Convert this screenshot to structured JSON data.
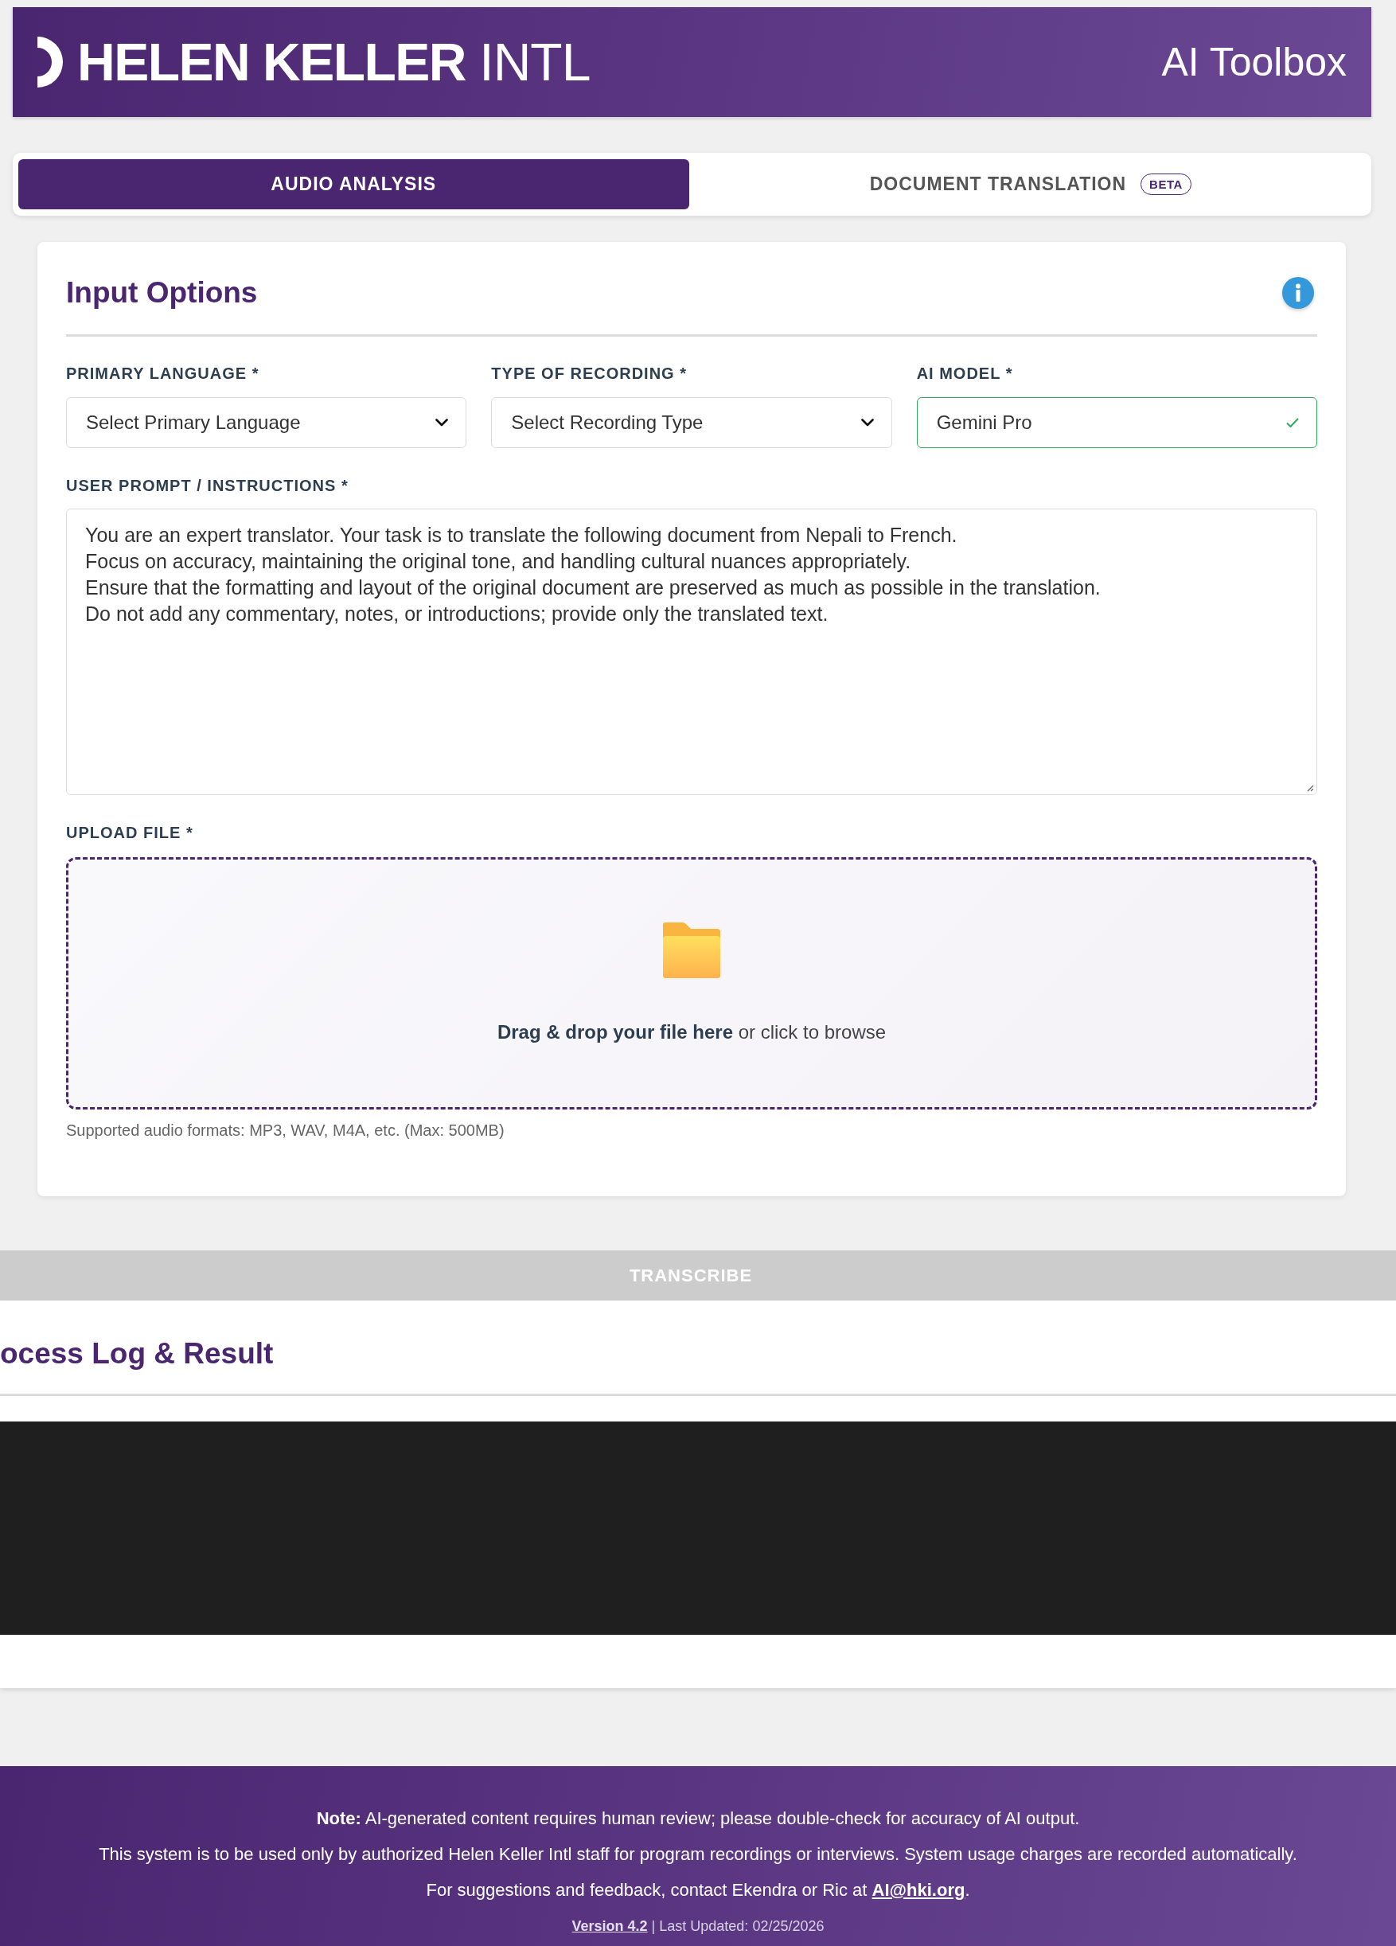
{
  "header": {
    "logo": "**HELEN KELLER** INTL",
    "app_title": "AI Toolbox"
  },
  "tabs": [
    {
      "label": "AUDIO ANALYSIS",
      "selected": true
    },
    {
      "label": "DOCUMENT TRANSLATION",
      "badge": "BETA",
      "selected": false
    }
  ],
  "input_options": {
    "title": "Input Options",
    "fields": [
      {
        "label": "PRIMARY LANGUAGE *",
        "placeholder": "Select Primary Language",
        "valid": false
      },
      {
        "label": "TYPE OF RECORDING *",
        "placeholder": "Select Recording Type",
        "valid": false
      },
      {
        "label": "AI MODEL *",
        "value": "Gemini Pro",
        "valid": true
      }
    ],
    "prompt": {
      "label": "USER PROMPT / INSTRUCTIONS *",
      "value": "You are an expert translator. Your task is to translate the following document from Nepali to French.\nFocus on accuracy, maintaining the original tone, and handling cultural nuances appropriately.\nEnsure that the formatting and layout of the original document are preserved as much as possible in the translation.\nDo not add any commentary, notes, or introductions; provide only the translated text."
    },
    "upload": {
      "label": "UPLOAD FILE *",
      "instructions": "**Drag & drop your file here** or click to browse",
      "hint": "Supported audio formats: MP3, WAV, M4A, etc. (Max: 500MB)"
    }
  },
  "transcribe_button": {
    "label": "TRANSCRIBE",
    "disabled": true
  },
  "process_log": {
    "title": "ocess Log & Result"
  },
  "footer": {
    "note": "**Note:** AI-generated content requires human review; please double-check for accuracy of AI output.",
    "notice": "This system is to be used only by authorized Helen Keller Intl staff for program recordings or interviews. System usage charges are recorded automatically.",
    "contact": {
      "text": "For suggestions and feedback, contact Ekendra or Ric at",
      "link": "AI@hki.org",
      "after": "."
    },
    "version": {
      "link": "Version 4.2",
      "separator": "|",
      "text": "Last Updated: 02/25/2026"
    }
  }
}
